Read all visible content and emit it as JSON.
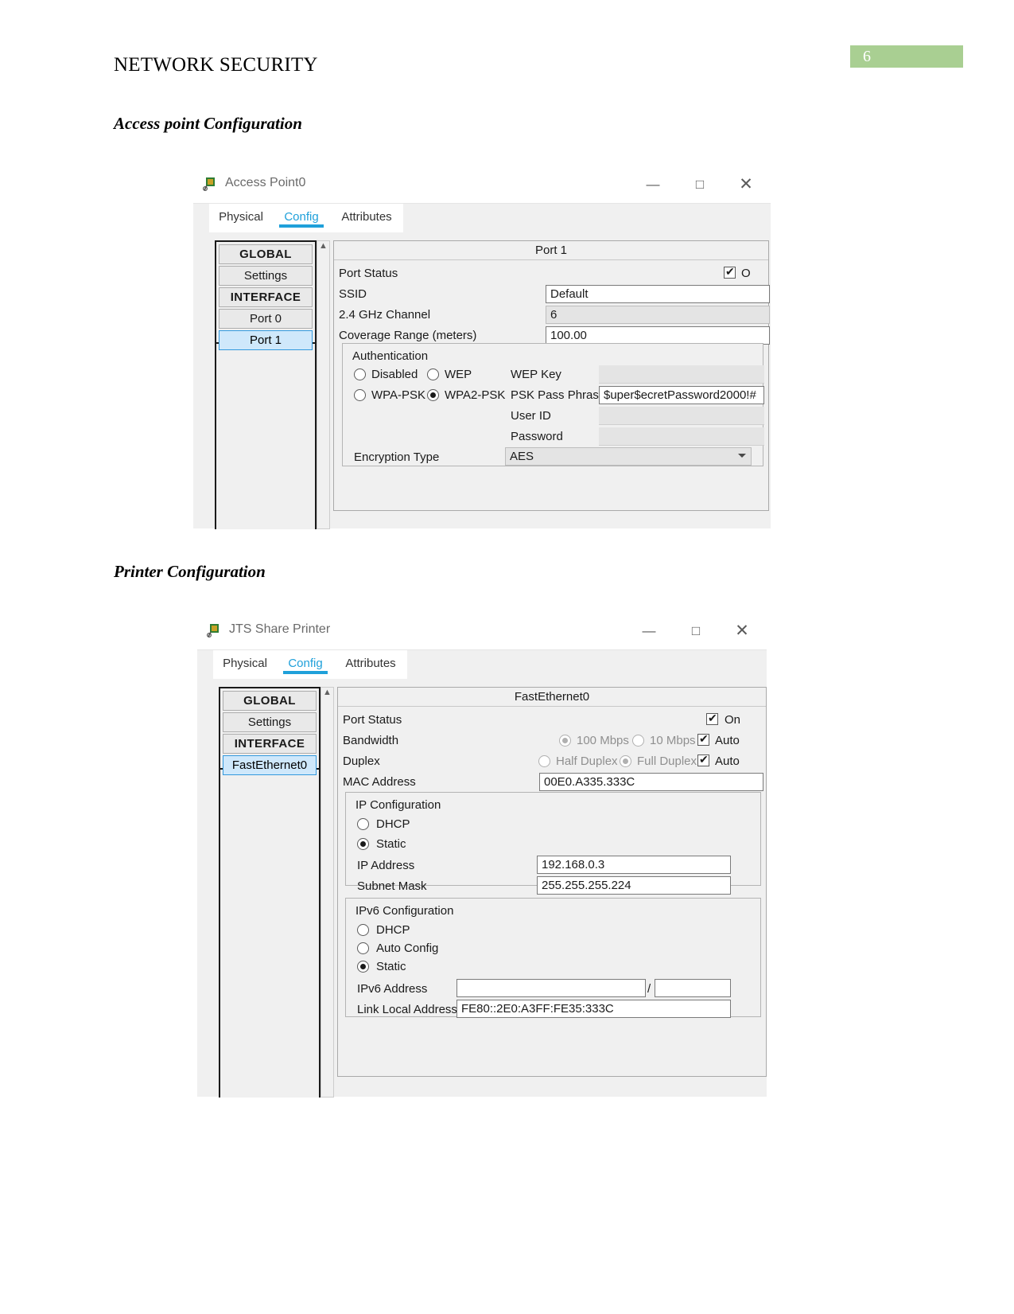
{
  "document": {
    "header_title": "NETWORK SECURITY",
    "page_number": "6",
    "badge_color": "#a9cf92",
    "sections": [
      {
        "heading": "Access point Configuration"
      },
      {
        "heading": "Printer Configuration"
      }
    ]
  },
  "accesspoint_window": {
    "title": "Access Point0",
    "icon": "packet-tracer-device-icon",
    "controls": {
      "minimize": "—",
      "maximize": "□",
      "close": "✕"
    },
    "tabs": [
      {
        "label": "Physical",
        "active": false
      },
      {
        "label": "Config",
        "active": true
      },
      {
        "label": "Attributes",
        "active": false
      }
    ],
    "nav": [
      {
        "label": "GLOBAL",
        "type": "header"
      },
      {
        "label": "Settings",
        "type": "item"
      },
      {
        "label": "INTERFACE",
        "type": "header"
      },
      {
        "label": "Port 0",
        "type": "item"
      },
      {
        "label": "Port 1",
        "type": "item",
        "selected": true
      }
    ],
    "panel": {
      "title": "Port 1",
      "port_status_label": "Port Status",
      "port_status_on_label": "O",
      "port_status_checked": true,
      "rows": [
        {
          "label": "SSID",
          "value": "Default"
        },
        {
          "label": "2.4 GHz Channel",
          "value": "6"
        },
        {
          "label": "Coverage Range (meters)",
          "value": "100.00"
        }
      ],
      "authentication": {
        "title": "Authentication",
        "options": [
          {
            "label": "Disabled",
            "selected": false
          },
          {
            "label": "WEP",
            "selected": false
          },
          {
            "label": "WPA-PSK",
            "selected": false
          },
          {
            "label": "WPA2-PSK",
            "selected": true
          }
        ],
        "fields": [
          {
            "label": "WEP Key",
            "value": ""
          },
          {
            "label": "PSK Pass Phrase",
            "value": "$uper$ecretPassword2000!#"
          },
          {
            "label": "User ID",
            "value": ""
          },
          {
            "label": "Password",
            "value": ""
          }
        ],
        "encryption_label": "Encryption Type",
        "encryption_value": "AES"
      }
    }
  },
  "printer_window": {
    "title": "JTS Share Printer",
    "icon": "packet-tracer-device-icon",
    "controls": {
      "minimize": "—",
      "maximize": "□",
      "close": "✕"
    },
    "tabs": [
      {
        "label": "Physical",
        "active": false
      },
      {
        "label": "Config",
        "active": true
      },
      {
        "label": "Attributes",
        "active": false
      }
    ],
    "nav": [
      {
        "label": "GLOBAL",
        "type": "header"
      },
      {
        "label": "Settings",
        "type": "item"
      },
      {
        "label": "INTERFACE",
        "type": "header"
      },
      {
        "label": "FastEthernet0",
        "type": "item",
        "selected": true
      }
    ],
    "panel": {
      "title": "FastEthernet0",
      "port_status": {
        "label": "Port Status",
        "on_label": "On",
        "checked": true
      },
      "bandwidth": {
        "label": "Bandwidth",
        "options": [
          {
            "label": "100 Mbps",
            "selected": true
          },
          {
            "label": "10 Mbps",
            "selected": false
          }
        ],
        "auto_label": "Auto",
        "auto_checked": true
      },
      "duplex": {
        "label": "Duplex",
        "options": [
          {
            "label": "Half Duplex",
            "selected": false
          },
          {
            "label": "Full Duplex",
            "selected": true
          }
        ],
        "auto_label": "Auto",
        "auto_checked": true
      },
      "mac": {
        "label": "MAC Address",
        "value": "00E0.A335.333C"
      },
      "ip_configuration": {
        "title": "IP Configuration",
        "modes": [
          {
            "label": "DHCP",
            "selected": false
          },
          {
            "label": "Static",
            "selected": true
          }
        ],
        "fields": [
          {
            "label": "IP Address",
            "value": "192.168.0.3"
          },
          {
            "label": "Subnet Mask",
            "value": "255.255.255.224"
          }
        ]
      },
      "ipv6_configuration": {
        "title": "IPv6 Configuration",
        "modes": [
          {
            "label": "DHCP",
            "selected": false
          },
          {
            "label": "Auto Config",
            "selected": false
          },
          {
            "label": "Static",
            "selected": true
          }
        ],
        "ipv6_address": {
          "label": "IPv6 Address",
          "value": "",
          "prefix_separator": "/",
          "prefix_value": ""
        },
        "link_local": {
          "label": "Link Local Address:",
          "value": "FE80::2E0:A3FF:FE35:333C"
        }
      }
    }
  }
}
